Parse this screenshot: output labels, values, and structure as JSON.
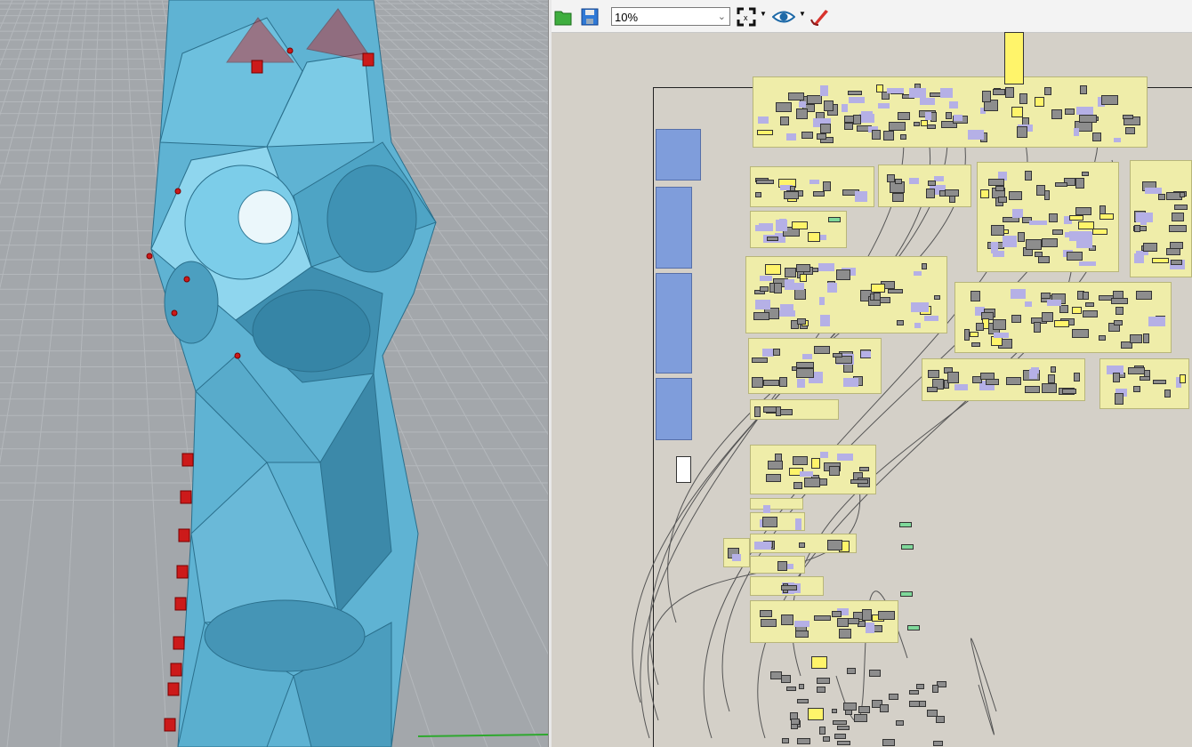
{
  "toolbar": {
    "open_icon": "folder-open-icon",
    "save_icon": "save-disk-icon",
    "zoom_value": "10%",
    "zoom_extents_icon": "zoom-extents-icon",
    "preview_icon": "eye-icon",
    "sketch_icon": "pen-brush-icon"
  },
  "colors": {
    "viewport_bg": "#a3a7ab",
    "model_blue": "#5fb3d3",
    "control_red": "#cc1a1a",
    "canvas_bg": "#d4d0c8",
    "group_yellow": "#efeda9",
    "panel_blue": "#7f9ddb",
    "node_gray": "#8d8d8d",
    "slider_green": "#7fd89a",
    "highlight_yellow": "#fff46a"
  }
}
